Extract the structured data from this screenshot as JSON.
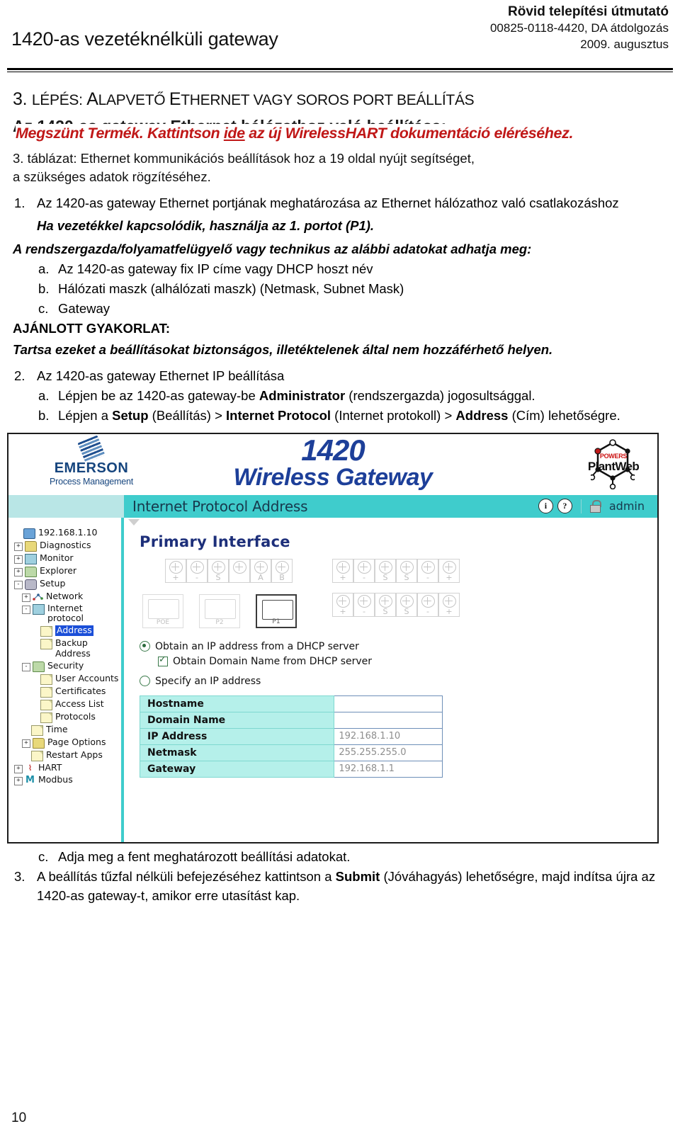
{
  "header": {
    "doc_title": "1420-as vezetéknélküli gateway",
    "right_line1": "Rövid telepítési útmutató",
    "right_line2": "00825-0118-4420, DA átdolgozás",
    "right_line3": "2009. augusztus"
  },
  "step": {
    "heading_num": "3. ",
    "heading_lepes": "LÉPÉS: ",
    "heading_a": "A",
    "heading_lapveto": "LAPVETŐ ",
    "heading_e": "E",
    "heading_thernet": "THERNET VAGY SOROS PORT BEÁLLÍTÁS",
    "faded_subhead": "Az 1420-as gateway Ethernet hálózathoz való beállítása:",
    "red_banner_pre": "Megszünt Termék. Kattintson ",
    "red_banner_link": "ide",
    "red_banner_post": " az új WirelessHART dokumentáció eléréséhez.",
    "table_ref_line1": "3. táblázat: Ethernet kommunikációs beállítások hoz a 19 oldal nyújt segítséget,",
    "table_ref_line2": "a szükséges adatok rögzítéséhez."
  },
  "items": {
    "i1_marker": "1.",
    "i1_text": "Az 1420-as gateway Ethernet portjának meghatározása az Ethernet hálózathoz való csatlakozáshoz",
    "i1_note": "Ha vezetékkel kapcsolódik, használja az 1. portot (P1).",
    "admin_note": "A rendszergazda/folyamatfelügyelő vagy technikus az alábbi adatokat adhatja meg:",
    "a_marker": "a.",
    "a_text": "Az 1420-as gateway fix IP címe vagy DHCP hoszt név",
    "b_marker": "b.",
    "b_text": "Hálózati maszk (alhálózati maszk) (Netmask, Subnet Mask)",
    "c_marker": "c.",
    "c_text": "Gateway",
    "best_practice_label": "AJÁNLOTT GYAKORLAT:",
    "best_practice_text": "Tartsa ezeket a beállításokat biztonságos, illetéktelenek által nem hozzáférhető helyen.",
    "i2_marker": "2.",
    "i2_text": "Az 1420-as gateway Ethernet IP beállítása",
    "i2a_marker": "a.",
    "i2a_pre": "Lépjen be az 1420-as gateway-be ",
    "i2a_bold": "Administrator",
    "i2a_post": " (rendszergazda) jogosultsággal.",
    "i2b_marker": "b.",
    "i2b_pre": "Lépjen a ",
    "i2b_b1": "Setup",
    "i2b_m1": " (Beállítás) > ",
    "i2b_b2": "Internet Protocol",
    "i2b_m2": " (Internet protokoll) > ",
    "i2b_b3": "Address",
    "i2b_post": " (Cím) lehetőségre."
  },
  "footer_items": {
    "c_marker": "c.",
    "c_text": "Adja meg a fent meghatározott beállítási adatokat.",
    "i3_marker": "3.",
    "i3_pre": "A beállítás tűzfal nélküli befejezéséhez kattintson a ",
    "i3_bold": "Submit",
    "i3_post": " (Jóváhagyás) lehetőségre, majd indítsa újra az 1420-as gateway-t, amikor erre utasítást kap."
  },
  "app": {
    "brand_word": "EMERSON",
    "brand_sub": "Process Management",
    "title_num": "1420",
    "title_name": "Wireless Gateway",
    "plantweb_powers": "POWERS",
    "plantweb_name": "PlantWeb",
    "nav_page_title": "Internet Protocol Address",
    "nav_info_icon": "i",
    "nav_help_icon": "?",
    "nav_user": "admin",
    "section_title": "Primary Interface",
    "terminal_labels_top_left": [
      "+",
      "-",
      "S",
      "",
      "A",
      "B"
    ],
    "terminal_labels_top_right": [
      "+",
      "-",
      "S",
      "S",
      "-",
      "+"
    ],
    "terminal_labels_bottom_right": [
      "+",
      "-",
      "S",
      "S",
      "-",
      "+"
    ],
    "ports": [
      {
        "name": "POE",
        "active": false
      },
      {
        "name": "P2",
        "active": false
      },
      {
        "name": "P1",
        "active": true
      }
    ],
    "radio_dhcp": "Obtain an IP address from a DHCP server",
    "checkbox_domain": "Obtain Domain Name from DHCP server",
    "radio_specify": "Specify an IP address",
    "form_rows": [
      {
        "label": "Hostname",
        "value": ""
      },
      {
        "label": "Domain Name",
        "value": ""
      },
      {
        "label": "IP Address",
        "value": "192.168.1.10"
      },
      {
        "label": "Netmask",
        "value": "255.255.255.0"
      },
      {
        "label": "Gateway",
        "value": "192.168.1.1"
      }
    ],
    "tree": [
      {
        "label": "192.168.1.10",
        "indent": 0,
        "toggle": "",
        "icon": "device-icon",
        "selected": false
      },
      {
        "label": "Diagnostics",
        "indent": 0,
        "toggle": "+",
        "icon": "folder-icon",
        "selected": false
      },
      {
        "label": "Monitor",
        "indent": 0,
        "toggle": "+",
        "icon": "monitor-icon",
        "selected": false
      },
      {
        "label": "Explorer",
        "indent": 0,
        "toggle": "+",
        "icon": "folder-search-icon",
        "selected": false
      },
      {
        "label": "Setup",
        "indent": 0,
        "toggle": "-",
        "icon": "gear-icon",
        "selected": false
      },
      {
        "label": "Network",
        "indent": 1,
        "toggle": "+",
        "icon": "network-icon",
        "selected": false
      },
      {
        "label": "Internet protocol",
        "indent": 1,
        "toggle": "-",
        "icon": "protocol-icon",
        "selected": false
      },
      {
        "label": "Address",
        "indent": 2,
        "toggle": "",
        "icon": "document-icon",
        "selected": true
      },
      {
        "label": "Backup Address",
        "indent": 2,
        "toggle": "",
        "icon": "document-icon",
        "selected": false
      },
      {
        "label": "Security",
        "indent": 1,
        "toggle": "-",
        "icon": "folder-green-icon",
        "selected": false
      },
      {
        "label": "User Accounts",
        "indent": 2,
        "toggle": "",
        "icon": "document-icon",
        "selected": false
      },
      {
        "label": "Certificates",
        "indent": 2,
        "toggle": "",
        "icon": "document-icon",
        "selected": false
      },
      {
        "label": "Access List",
        "indent": 2,
        "toggle": "",
        "icon": "document-icon",
        "selected": false
      },
      {
        "label": "Protocols",
        "indent": 2,
        "toggle": "",
        "icon": "document-icon",
        "selected": false
      },
      {
        "label": "Time",
        "indent": 1,
        "toggle": "",
        "icon": "document-icon",
        "selected": false
      },
      {
        "label": "Page Options",
        "indent": 1,
        "toggle": "+",
        "icon": "folder-icon",
        "selected": false
      },
      {
        "label": "Restart Apps",
        "indent": 1,
        "toggle": "",
        "icon": "document-icon",
        "selected": false
      },
      {
        "label": "HART",
        "indent": 0,
        "toggle": "+",
        "icon": "hart-icon",
        "selected": false
      },
      {
        "label": "Modbus",
        "indent": 0,
        "toggle": "+",
        "icon": "modbus-icon",
        "selected": false
      }
    ]
  },
  "page_number": "10",
  "colors": {
    "teal": "#3fcccc",
    "teal_light": "#b5f0ea",
    "brand_blue": "#1d3f99",
    "red": "#c01818",
    "select_blue": "#1b4fd8"
  }
}
